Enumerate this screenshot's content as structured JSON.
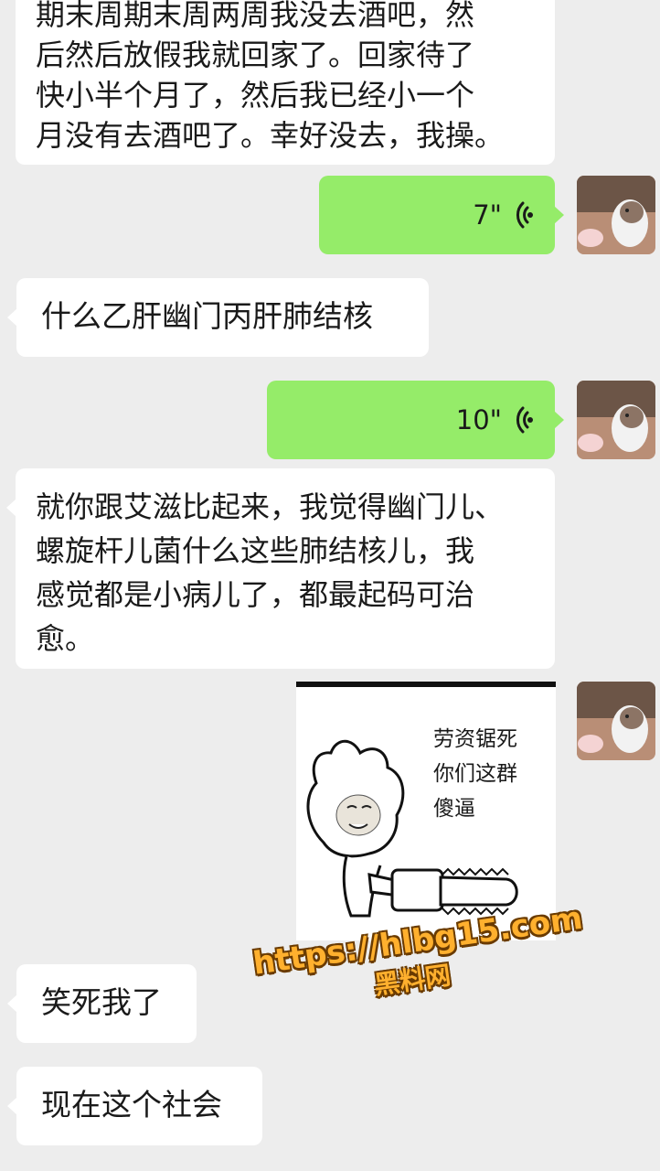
{
  "messages": {
    "m1": {
      "side": "left",
      "text": "期末周期末周两周我没去酒吧，然\n后然后放假我就回家了。回家待了\n快小半个月了，然后我已经小一个\n月没有去酒吧了。幸好没去，我操。"
    },
    "m2": {
      "side": "right",
      "type": "voice",
      "duration": "7\""
    },
    "m3": {
      "side": "left",
      "text": "什么乙肝幽门丙肝肺结核"
    },
    "m4": {
      "side": "right",
      "type": "voice",
      "duration": "10\""
    },
    "m5": {
      "side": "left",
      "text": "就你跟艾滋比起来，我觉得幽门儿、\n螺旋杆儿菌什么这些肺结核儿，我\n感觉都是小病儿了，都最起码可治\n愈。"
    },
    "m6": {
      "side": "right",
      "type": "sticker",
      "caption": "劳资锯死\n你们这群\n傻逼"
    },
    "m7": {
      "side": "left",
      "text": "笑死我了"
    },
    "m8": {
      "side": "left",
      "text": "现在这个社会"
    }
  },
  "watermark": {
    "url": "https://hlbg15.com",
    "name": "黑料网"
  },
  "colors": {
    "background": "#ededed",
    "left_bubble": "#ffffff",
    "right_bubble": "#95ec69",
    "watermark": "#ffb02e"
  },
  "icons": {
    "voice": "voice-wave-icon",
    "avatar": "hamster-avatar"
  }
}
